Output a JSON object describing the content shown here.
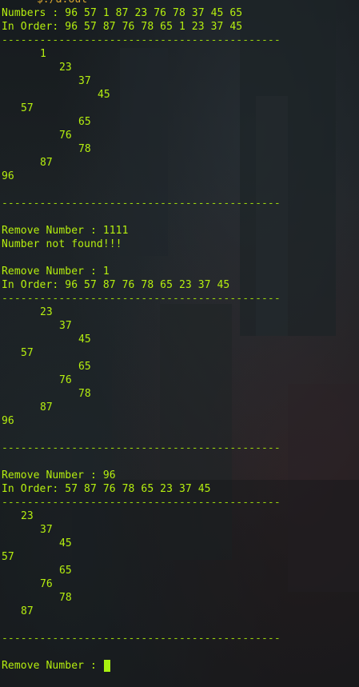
{
  "terminal": {
    "prompt_partial": "─ $./a.out",
    "numbers": "Numbers : 96 57 1 87 23 76 78 37 45 65",
    "inorder_1": "In Order: 96 57 87 76 78 65 1 23 37 45",
    "separator": "--------------------------------------------",
    "tree_1": [
      "1",
      "23",
      "37",
      "45",
      "57",
      "65",
      "76",
      "78",
      "87",
      "96"
    ],
    "remove_1": "Remove Number : 1111",
    "not_found": "Number not found!!!",
    "remove_2": "Remove Number : 1",
    "inorder_2": "In Order: 96 57 87 76 78 65 23 37 45",
    "tree_2": [
      "23",
      "37",
      "45",
      "57",
      "65",
      "76",
      "78",
      "87",
      "96"
    ],
    "remove_3": "Remove Number : 96",
    "inorder_3": "In Order: 57 87 76 78 65 23 37 45",
    "tree_3": [
      "23",
      "37",
      "45",
      "57",
      "65",
      "76",
      "78",
      "87"
    ],
    "remove_prompt": "Remove Number : "
  }
}
